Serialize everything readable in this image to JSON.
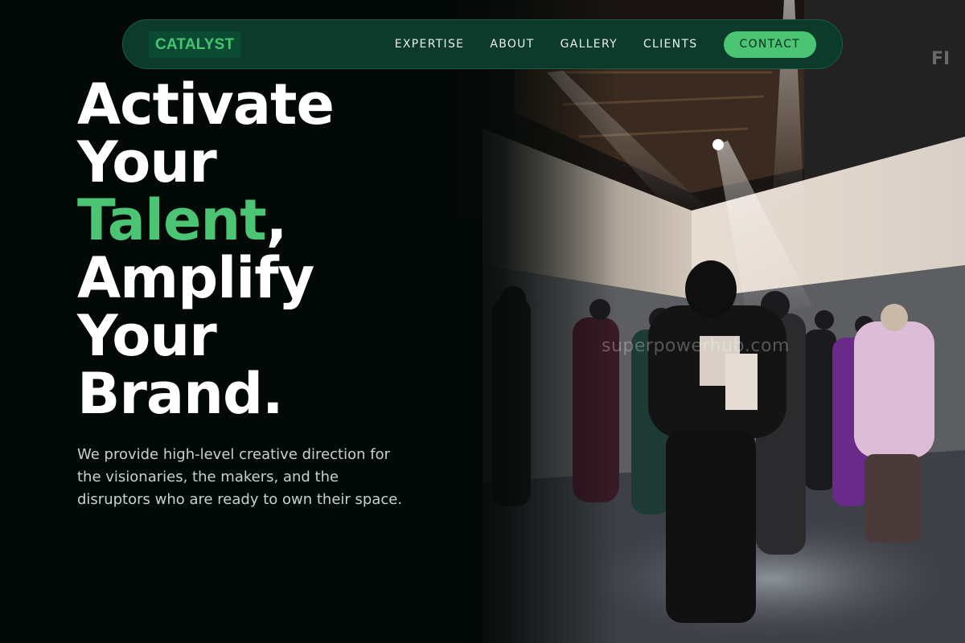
{
  "nav": {
    "logo": "CATALYST",
    "links": [
      "EXPERTISE",
      "ABOUT",
      "GALLERY",
      "CLIENTS"
    ],
    "contact": "CONTACT"
  },
  "hero": {
    "line1": "Activate",
    "line2": "Your",
    "line3_accent": "Talent",
    "line3_rest": ",",
    "line4": "Amplify",
    "line5": "Your",
    "line6": "Brand.",
    "subtext": "We provide high-level creative direction for the visionaries, the makers, and the disruptors who are ready to own their space.",
    "watermark": "superpowerhub.com"
  },
  "colors": {
    "accent": "#4bc573",
    "nav_bg": "#0c3b2c",
    "page_bg": "#030907"
  },
  "icons": {
    "hero_image": "fashion-event-photo"
  }
}
